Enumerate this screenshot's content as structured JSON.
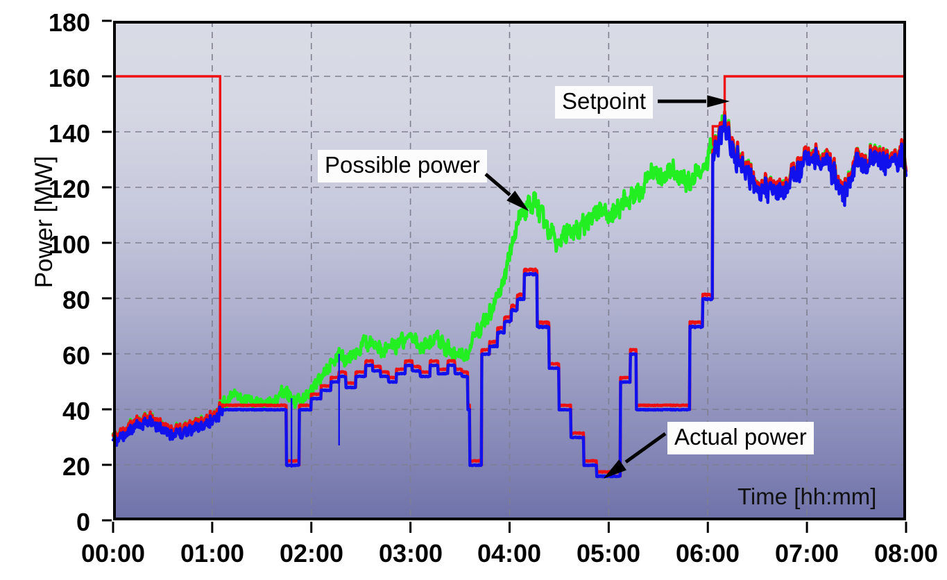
{
  "chart_data": {
    "type": "line",
    "title": "",
    "xlabel": "Time [hh:mm]",
    "ylabel": "Power [MW]",
    "xlim": [
      0,
      8
    ],
    "ylim": [
      0,
      180
    ],
    "yticks": [
      0,
      20,
      40,
      60,
      80,
      100,
      120,
      140,
      160,
      180
    ],
    "xticks": [
      "00:00",
      "01:00",
      "02:00",
      "03:00",
      "04:00",
      "05:00",
      "06:00",
      "07:00",
      "08:00"
    ],
    "grid": true,
    "legend": "annotations",
    "annotations": [
      {
        "label": "Setpoint",
        "arrow": "right",
        "target_time": 6.17,
        "target_value": 150
      },
      {
        "label": "Possible power",
        "arrow": "down-right",
        "target_time": 3.93,
        "target_value": 113
      },
      {
        "label": "Actual power",
        "arrow": "down-left",
        "target_time": 5.08,
        "target_value": 16
      }
    ],
    "series": [
      {
        "name": "Setpoint",
        "color": "#ee1111",
        "style": "step",
        "points": [
          [
            0.0,
            160
          ],
          [
            1.08,
            160
          ],
          [
            1.08,
            40
          ],
          [
            1.75,
            40
          ],
          [
            1.75,
            20
          ],
          [
            1.88,
            20
          ],
          [
            1.88,
            40
          ],
          [
            2.0,
            44
          ],
          [
            2.1,
            47
          ],
          [
            2.2,
            50
          ],
          [
            2.28,
            52
          ],
          [
            2.35,
            48
          ],
          [
            2.45,
            52
          ],
          [
            2.55,
            56
          ],
          [
            2.62,
            54
          ],
          [
            2.7,
            52
          ],
          [
            2.78,
            50
          ],
          [
            2.86,
            53
          ],
          [
            2.95,
            56
          ],
          [
            3.02,
            54
          ],
          [
            3.1,
            52
          ],
          [
            3.2,
            56
          ],
          [
            3.28,
            53
          ],
          [
            3.38,
            56
          ],
          [
            3.45,
            53
          ],
          [
            3.52,
            52
          ],
          [
            3.58,
            40
          ],
          [
            3.6,
            20
          ],
          [
            3.7,
            20
          ],
          [
            3.72,
            60
          ],
          [
            3.8,
            63
          ],
          [
            3.88,
            68
          ],
          [
            3.95,
            72
          ],
          [
            4.02,
            76
          ],
          [
            4.08,
            80
          ],
          [
            4.15,
            89
          ],
          [
            4.28,
            89
          ],
          [
            4.28,
            70
          ],
          [
            4.4,
            70
          ],
          [
            4.4,
            55
          ],
          [
            4.5,
            55
          ],
          [
            4.5,
            40
          ],
          [
            4.62,
            40
          ],
          [
            4.62,
            30
          ],
          [
            4.75,
            30
          ],
          [
            4.75,
            20
          ],
          [
            4.88,
            20
          ],
          [
            4.88,
            16
          ],
          [
            5.12,
            16
          ],
          [
            5.12,
            50
          ],
          [
            5.22,
            50
          ],
          [
            5.22,
            60
          ],
          [
            5.28,
            60
          ],
          [
            5.28,
            40
          ],
          [
            5.82,
            40
          ],
          [
            5.82,
            70
          ],
          [
            5.95,
            70
          ],
          [
            5.95,
            80
          ],
          [
            6.05,
            80
          ],
          [
            6.05,
            142
          ],
          [
            6.17,
            142
          ],
          [
            6.17,
            160
          ],
          [
            8.0,
            160
          ]
        ]
      },
      {
        "name": "Possible power",
        "color": "#22ee22",
        "style": "noisy-line",
        "description": "Available wind power; rises from ~30 MW at 00:00 to ~130 MW by 08:00",
        "anchor_points": [
          [
            0.0,
            30
          ],
          [
            0.1,
            32
          ],
          [
            0.22,
            36
          ],
          [
            0.32,
            38
          ],
          [
            0.42,
            36
          ],
          [
            0.55,
            33
          ],
          [
            0.68,
            33
          ],
          [
            0.82,
            34
          ],
          [
            0.95,
            36
          ],
          [
            1.05,
            39
          ],
          [
            1.12,
            42
          ],
          [
            1.22,
            46
          ],
          [
            1.3,
            45
          ],
          [
            1.42,
            43
          ],
          [
            1.52,
            42
          ],
          [
            1.62,
            43
          ],
          [
            1.72,
            47
          ],
          [
            1.8,
            44
          ],
          [
            1.9,
            43
          ],
          [
            2.0,
            47
          ],
          [
            2.1,
            52
          ],
          [
            2.18,
            56
          ],
          [
            2.28,
            60
          ],
          [
            2.35,
            57
          ],
          [
            2.45,
            60
          ],
          [
            2.55,
            65
          ],
          [
            2.62,
            63
          ],
          [
            2.72,
            61
          ],
          [
            2.8,
            62
          ],
          [
            2.88,
            64
          ],
          [
            2.97,
            67
          ],
          [
            3.05,
            64
          ],
          [
            3.15,
            62
          ],
          [
            3.25,
            66
          ],
          [
            3.35,
            62
          ],
          [
            3.45,
            60
          ],
          [
            3.55,
            59
          ],
          [
            3.62,
            64
          ],
          [
            3.72,
            70
          ],
          [
            3.8,
            74
          ],
          [
            3.88,
            80
          ],
          [
            3.95,
            88
          ],
          [
            4.02,
            98
          ],
          [
            4.1,
            108
          ],
          [
            4.18,
            114
          ],
          [
            4.25,
            116
          ],
          [
            4.33,
            110
          ],
          [
            4.42,
            103
          ],
          [
            4.52,
            101
          ],
          [
            4.6,
            105
          ],
          [
            4.7,
            104
          ],
          [
            4.8,
            108
          ],
          [
            4.9,
            112
          ],
          [
            5.0,
            110
          ],
          [
            5.1,
            113
          ],
          [
            5.22,
            117
          ],
          [
            5.32,
            120
          ],
          [
            5.42,
            124
          ],
          [
            5.52,
            122
          ],
          [
            5.62,
            126
          ],
          [
            5.72,
            124
          ],
          [
            5.82,
            122
          ],
          [
            5.92,
            126
          ],
          [
            6.02,
            132
          ],
          [
            6.1,
            138
          ],
          [
            6.17,
            143
          ],
          [
            6.28,
            134
          ],
          [
            6.38,
            127
          ],
          [
            6.48,
            122
          ],
          [
            6.58,
            120
          ],
          [
            6.68,
            122
          ],
          [
            6.78,
            121
          ],
          [
            6.88,
            126
          ],
          [
            6.98,
            130
          ],
          [
            7.08,
            133
          ],
          [
            7.18,
            131
          ],
          [
            7.28,
            124
          ],
          [
            7.36,
            119
          ],
          [
            7.46,
            126
          ],
          [
            7.58,
            131
          ],
          [
            7.68,
            133
          ],
          [
            7.78,
            130
          ],
          [
            7.88,
            133
          ],
          [
            8.0,
            131
          ]
        ]
      },
      {
        "name": "Actual power",
        "color": "#1111ee",
        "style": "noisy-step",
        "description": "Delivered power; tracks possible power when below setpoint, otherwise clamped to setpoint",
        "dropouts": [
          {
            "time": 2.28,
            "value": 27
          },
          {
            "time": 1.8,
            "value": 19
          }
        ]
      }
    ]
  }
}
